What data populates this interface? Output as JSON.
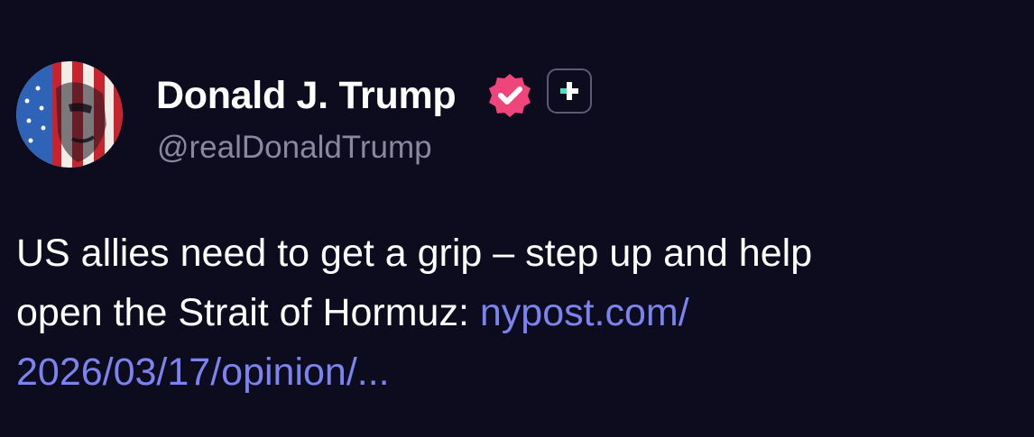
{
  "author": {
    "display_name": "Donald J. Trump",
    "handle": "@realDonaldTrump",
    "avatar_icon": "flag-portrait-avatar",
    "verified_icon": "verified-badge-icon",
    "verified_color": "#f0457a",
    "plus_icon": "plus-badge-icon",
    "plus_color": "#3ee6c4"
  },
  "post": {
    "line1": "US allies need to get a grip – step up and help",
    "line2_text": "open the Strait of Hormuz: ",
    "link_part1": "nypost.com/",
    "link_part2": "2026/03/17/opinion/..."
  },
  "colors": {
    "background": "#0d0b1e",
    "text": "#ffffff",
    "handle": "#8b879f",
    "link": "#7c83ee"
  }
}
